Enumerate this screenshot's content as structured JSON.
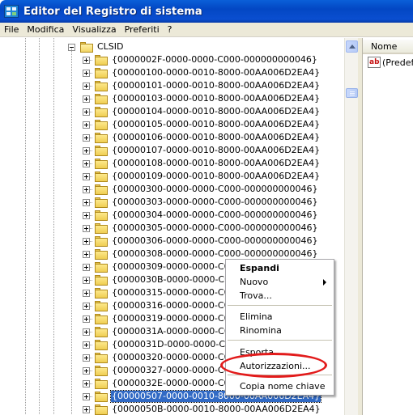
{
  "window": {
    "title": "Editor del Registro di sistema",
    "app_icon": "regedit-icon"
  },
  "menubar": {
    "items": [
      "File",
      "Modifica",
      "Visualizza",
      "Preferiti",
      "?"
    ]
  },
  "tree": {
    "root_label": "CLSID",
    "children": [
      "{0000002F-0000-0000-C000-000000000046}",
      "{00000100-0000-0010-8000-00AA006D2EA4}",
      "{00000101-0000-0010-8000-00AA006D2EA4}",
      "{00000103-0000-0010-8000-00AA006D2EA4}",
      "{00000104-0000-0010-8000-00AA006D2EA4}",
      "{00000105-0000-0010-8000-00AA006D2EA4}",
      "{00000106-0000-0010-8000-00AA006D2EA4}",
      "{00000107-0000-0010-8000-00AA006D2EA4}",
      "{00000108-0000-0010-8000-00AA006D2EA4}",
      "{00000109-0000-0010-8000-00AA006D2EA4}",
      "{00000300-0000-0000-C000-000000000046}",
      "{00000303-0000-0000-C000-000000000046}",
      "{00000304-0000-0000-C000-000000000046}",
      "{00000305-0000-0000-C000-000000000046}",
      "{00000306-0000-0000-C000-000000000046}",
      "{00000308-0000-0000-C000-000000000046}",
      "{00000309-0000-0000-C000",
      "{0000030B-0000-0000-C000",
      "{00000315-0000-0000-C000",
      "{00000316-0000-0000-C000",
      "{00000319-0000-0000-C000",
      "{0000031A-0000-0000-C000",
      "{0000031D-0000-0000-C000",
      "{00000320-0000-0000-C000",
      "{00000327-0000-0000-C000",
      "{0000032E-0000-0000-C000",
      "{00000507-0000-0010-8000-00AA006D2EA4}",
      "{0000050B-0000-0010-8000-00AA006D2EA4}"
    ],
    "selected_index": 26
  },
  "list": {
    "column_name": "Nome",
    "rows": [
      {
        "icon": "string-value-icon",
        "icon_text": "ab",
        "name": "(Predefi"
      }
    ]
  },
  "context_menu": {
    "items": [
      {
        "label": "Espandi",
        "bold": true
      },
      {
        "label": "Nuovo",
        "submenu": true
      },
      {
        "label": "Trova..."
      },
      {
        "separator": true
      },
      {
        "label": "Elimina"
      },
      {
        "label": "Rinomina"
      },
      {
        "separator": true
      },
      {
        "label": "Esporta"
      },
      {
        "label": "Autorizzazioni..."
      },
      {
        "separator": true
      },
      {
        "label": "Copia nome chiave"
      }
    ],
    "highlighted_label": "Autorizzazioni..."
  },
  "colors": {
    "title_bar": "#0a4ed0",
    "selection": "#316ac5",
    "annotation": "#e21b1b"
  }
}
